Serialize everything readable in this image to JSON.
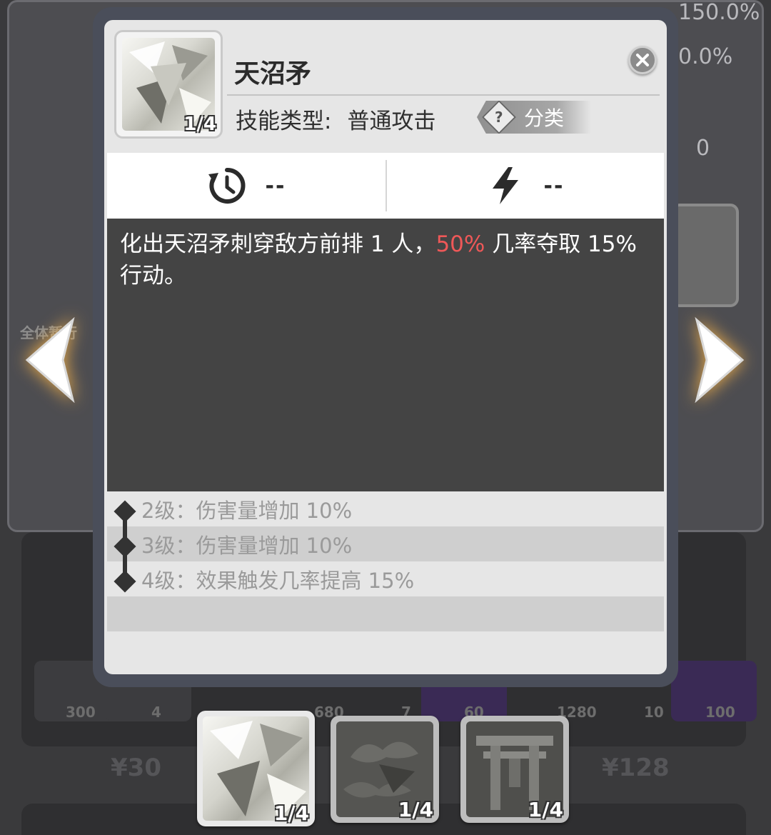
{
  "background": {
    "stats": [
      "150.0%",
      "0.0%",
      "0"
    ],
    "left_text": "全体暂行",
    "shop_quantities": [
      "300",
      "4",
      "680",
      "7",
      "60",
      "1280",
      "10",
      "100"
    ],
    "prices": [
      "¥30",
      "¥128"
    ]
  },
  "skill": {
    "name": "天沼矛",
    "level": "1/4",
    "type_label": "技能类型:",
    "type_value": "普通攻击",
    "category_icon": "?",
    "category_label": "分类",
    "cooldown_icon": "cooldown-clock-icon",
    "cooldown_value": "--",
    "energy_icon": "lightning-icon",
    "energy_value": "--",
    "description_before": "化出天沼矛刺穿敌方前排 1 人，",
    "description_highlight": "50%",
    "description_after": " 几率夺取 15% 行动。",
    "highlight_color": "#ef5858",
    "upgrades": [
      "2级：伤害量增加 10%",
      "3级：伤害量增加 10%",
      "4级：效果触发几率提高 15%"
    ]
  },
  "tabs": [
    {
      "level": "1/4"
    },
    {
      "level": "1/4"
    },
    {
      "level": "1/4"
    }
  ]
}
